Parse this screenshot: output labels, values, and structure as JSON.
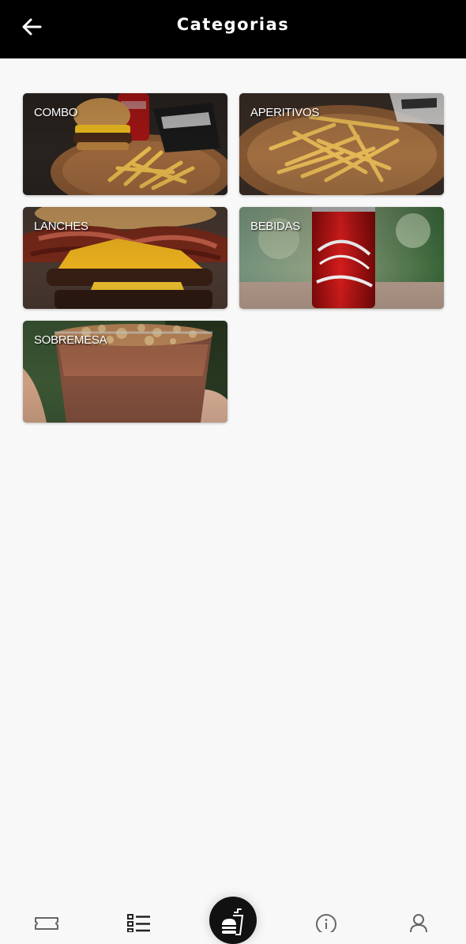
{
  "header": {
    "title": "Categorias",
    "back_icon": "arrow-left-icon"
  },
  "categories": [
    {
      "label": "COMBO",
      "image": "burger-fries-coke-photo"
    },
    {
      "label": "APERITIVOS",
      "image": "french-fries-photo"
    },
    {
      "label": "LANCHES",
      "image": "bacon-cheeseburger-photo"
    },
    {
      "label": "BEBIDAS",
      "image": "coca-cola-can-photo"
    },
    {
      "label": "SOBREMESA",
      "image": "dessert-cup-photo"
    }
  ],
  "bottom_nav": {
    "items": [
      {
        "icon": "ticket-icon"
      },
      {
        "icon": "list-icon"
      },
      {
        "icon": "burger-drink-icon"
      },
      {
        "icon": "info-icon"
      },
      {
        "icon": "user-icon"
      }
    ]
  },
  "colors": {
    "header_bg": "#000000",
    "page_bg": "#f8f8f8",
    "icon_gray": "#666666"
  }
}
